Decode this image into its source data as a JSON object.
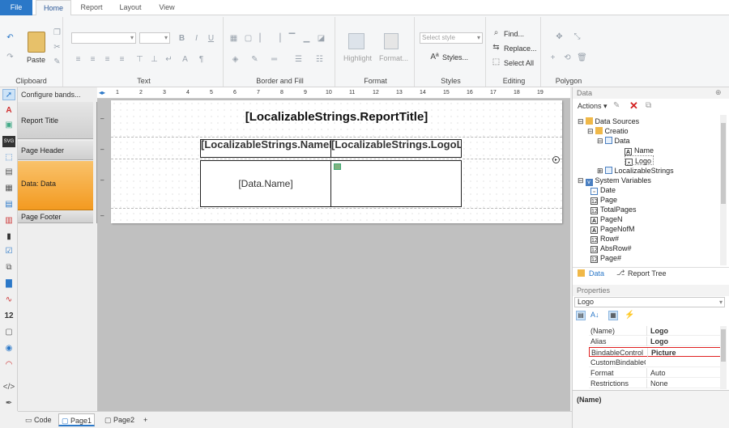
{
  "tabs": [
    "File",
    "Home",
    "Report",
    "Layout",
    "View"
  ],
  "ribbon": {
    "clipboard": {
      "paste": "Paste",
      "label": "Clipboard"
    },
    "text": {
      "label": "Text"
    },
    "border_fill": {
      "label": "Border and Fill"
    },
    "format": {
      "highlight": "Highlight",
      "format": "Format...",
      "label": "Format"
    },
    "styles": {
      "select_style": "Select style",
      "styles": "Styles...",
      "label": "Styles"
    },
    "editing": {
      "find": "Find...",
      "replace": "Replace...",
      "select_all": "Select All",
      "label": "Editing"
    },
    "polygon": {
      "label": "Polygon"
    }
  },
  "bands": {
    "configure": "Configure bands...",
    "items": [
      "Report Title",
      "Page Header",
      "Data: Data",
      "Page Footer"
    ]
  },
  "ruler": [
    "1",
    "2",
    "3",
    "4",
    "5",
    "6",
    "7",
    "8",
    "9",
    "10",
    "11",
    "12",
    "13",
    "14",
    "15",
    "16",
    "17",
    "18",
    "19"
  ],
  "report": {
    "title": "[LocalizableStrings.ReportTitle]",
    "header_name": "[LocalizableStrings.NameLabel]",
    "header_logo": "[LocalizableStrings.LogoLabel]",
    "data_name": "[Data.Name]"
  },
  "data_panel": {
    "title": "Data",
    "actions": "Actions",
    "tree": [
      "Data Sources",
      "Creatio",
      "Data",
      "Name",
      "Logo",
      "LocalizableStrings",
      "System Variables",
      "Date",
      "Page",
      "TotalPages",
      "PageN",
      "PageNofM",
      "Row#",
      "AbsRow#",
      "Page#"
    ],
    "tab_data": "Data",
    "tab_tree": "Report Tree"
  },
  "properties": {
    "title": "Properties",
    "selected": "Logo",
    "rows": [
      {
        "name": "(Name)",
        "value": "Logo"
      },
      {
        "name": "Alias",
        "value": "Logo"
      },
      {
        "name": "BindableControl",
        "value": "Picture"
      },
      {
        "name": "CustomBindableCo",
        "value": ""
      },
      {
        "name": "Format",
        "value": "Auto"
      },
      {
        "name": "Restrictions",
        "value": "None"
      }
    ],
    "description": "(Name)"
  },
  "bottom": {
    "code": "Code",
    "page1": "Page1",
    "page2": "Page2",
    "add": "+"
  },
  "colors": {
    "accent": "#2b78c8",
    "band_active": "#f7a538",
    "highlight_border": "#e02020"
  }
}
